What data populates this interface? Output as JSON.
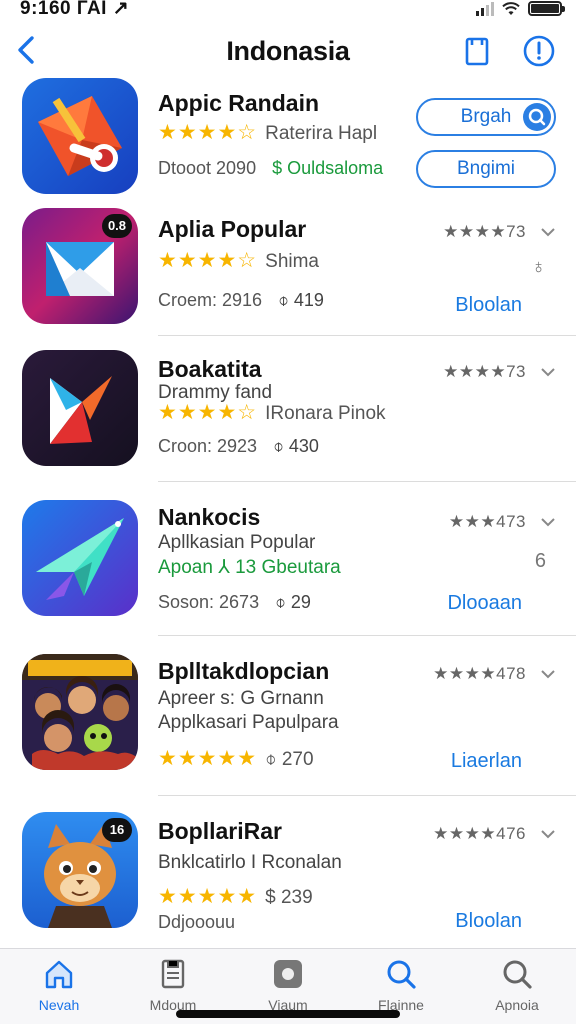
{
  "status": {
    "time": "9:160 ГАІ ↗"
  },
  "nav": {
    "title": "Indonasia",
    "back_icon": "chevron-left-icon",
    "bookmark_icon": "bookmark-icon",
    "info_icon": "info-icon"
  },
  "apps": [
    {
      "name": "Appic Randain",
      "stars": "★★★★☆",
      "rating_text": "Raterira Hapl",
      "meta_left": "Dtooot 2090",
      "price": "$ Ouldsaloma",
      "pill1": "Brgah",
      "pill2": "Bngimi"
    },
    {
      "name": "Aplia Popular",
      "stars": "★★★★☆",
      "rating_text": "Shima",
      "meta_left": "Croem: 2916",
      "price": "⌽ 419",
      "right_rating": "★★★★73",
      "mini": "♁",
      "get": "Bloolan",
      "badge": "0.8"
    },
    {
      "name": "Boakatita",
      "sub": "Drammy fand",
      "stars": "★★★★☆",
      "rating_text": "IRonara Pinok",
      "meta_left": "Croon: 2923",
      "price": "⌽ 430",
      "right_rating": "★★★★73"
    },
    {
      "name": "Nankocis",
      "sub": "Apllkasian Popular",
      "green_line": "Apoan ⅄ 13  Gbeutara",
      "meta_left": "Soson: 2673",
      "price": "⌽ 29",
      "right_rating": "★★★473",
      "mini": "6",
      "get": "Dlooaan"
    },
    {
      "name": "Bplltakdlopcian",
      "sub": "Apreer s: G Grnann",
      "sub2": "Applkasari Papulpara",
      "stars": "★★★★★",
      "price_inline": "⌽ 270",
      "right_rating": "★★★★478",
      "get": "Liaerlan"
    },
    {
      "name": "BopllariRar",
      "sub": "Bnklcatirlo I Rconalan",
      "stars": "★★★★★",
      "price_inline": "$ 239",
      "meta_left": "Ddjooouu",
      "right_rating": "★★★★476",
      "get": "Bloolan",
      "badge": "16"
    }
  ],
  "tabs": [
    {
      "label": "Nevah",
      "icon": "home-icon"
    },
    {
      "label": "Mdoum",
      "icon": "document-icon"
    },
    {
      "label": "Viaum",
      "icon": "media-icon"
    },
    {
      "label": "Flainne",
      "icon": "search-icon"
    },
    {
      "label": "Apnoia",
      "icon": "search-icon"
    }
  ],
  "colors": {
    "accent": "#1a73e8",
    "star": "#f7b500",
    "green": "#1a9a3c"
  }
}
